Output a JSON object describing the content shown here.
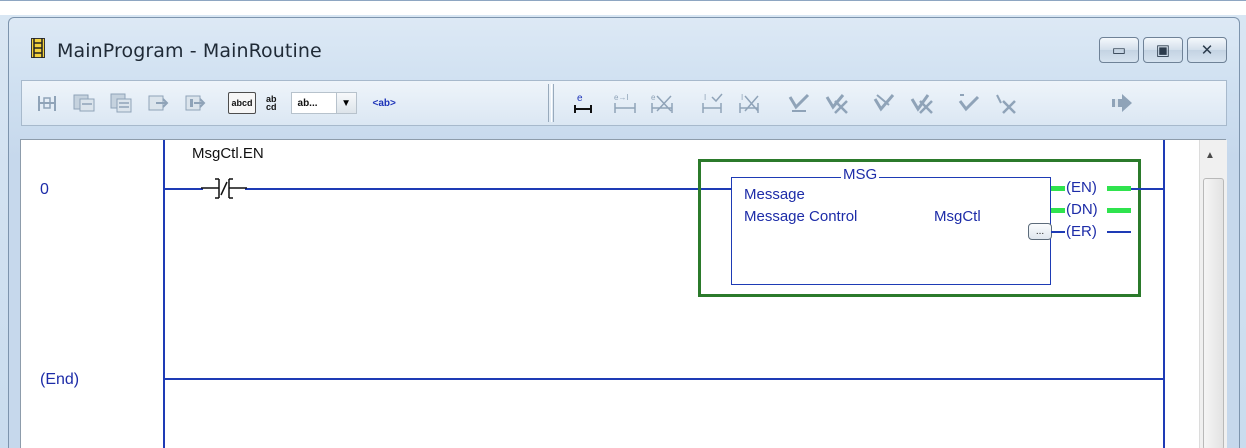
{
  "window": {
    "title": "MainProgram - MainRoutine",
    "buttons": [
      {
        "name": "minimize",
        "icon": "minimize-icon",
        "glyph": "▭"
      },
      {
        "name": "restore",
        "icon": "restore-icon",
        "glyph": "▣"
      },
      {
        "name": "close",
        "icon": "close-icon",
        "glyph": "✕"
      }
    ]
  },
  "toolbar": {
    "abcd_label": "abcd",
    "ab_cd_top": "ab",
    "ab_cd_bottom": "cd",
    "combo_value": "ab...",
    "tag_label": "<ab>"
  },
  "ladder": {
    "rungs": [
      {
        "number": "0"
      },
      {
        "number": "(End)"
      }
    ],
    "contact_tag": "MsgCtl.EN",
    "contact_symbol": "]/[",
    "instruction": {
      "name": "MSG",
      "line1": "Message",
      "line2": "Message Control",
      "control_value": "MsgCtl",
      "ellipsis": "...",
      "outputs": [
        "EN",
        "DN",
        "ER"
      ]
    }
  },
  "colors": {
    "rung_blue": "#1e3bb5",
    "active_green": "#2fe34e",
    "box_green": "#2b7a2b"
  }
}
